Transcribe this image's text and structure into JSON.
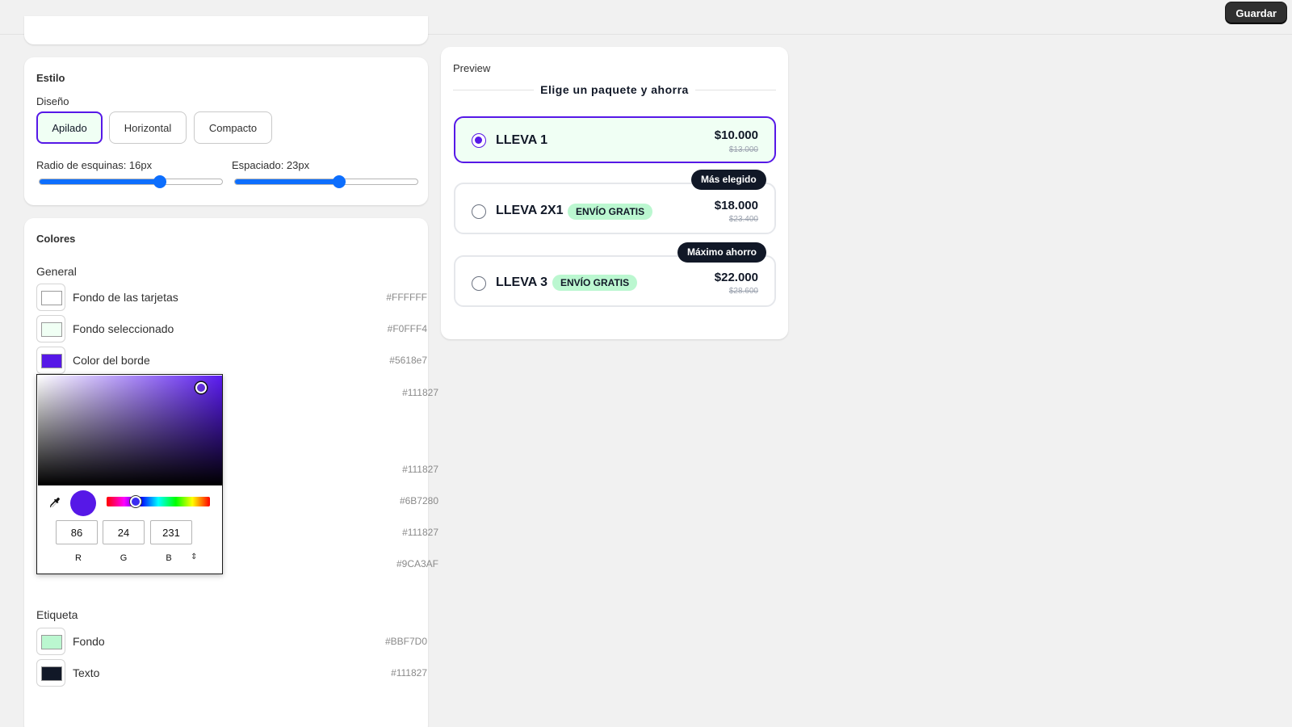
{
  "topbar": {
    "save_label": "Guardar"
  },
  "style": {
    "title": "Estilo",
    "design_label": "Diseño",
    "layouts": [
      "Apilado",
      "Horizontal",
      "Compacto"
    ],
    "selected_layout": "Apilado",
    "radius_label": "Radio de esquinas: 16px",
    "radius_value_fraction": 0.66,
    "spacing_label": "Espaciado: 23px",
    "spacing_value_fraction": 0.57
  },
  "colors": {
    "title": "Colores",
    "general_label": "General",
    "general": [
      {
        "name": "Fondo de las tarjetas",
        "hex": "#FFFFFF"
      },
      {
        "name": "Fondo seleccionado",
        "hex": "#F0FFF4"
      },
      {
        "name": "Color del borde",
        "hex": "#5618e7"
      }
    ],
    "hidden_hexes": [
      "#111827",
      "#111827",
      "#6B7280",
      "#111827",
      "#9CA3AF"
    ],
    "tag_label": "Etiqueta",
    "tag": [
      {
        "name": "Fondo",
        "hex": "#BBF7D0"
      },
      {
        "name": "Texto",
        "hex": "#111827"
      }
    ]
  },
  "picker": {
    "r": "86",
    "g": "24",
    "b": "231",
    "r_label": "R",
    "g_label": "G",
    "b_label": "B",
    "mode_toggle": "⇕",
    "color": "#5618e7"
  },
  "preview": {
    "title": "Preview",
    "heading": "Elige un paquete y ahorra",
    "bundles": [
      {
        "title": "LLEVA 1",
        "tag": "",
        "badge": "",
        "price": "$10.000",
        "old_price": "$13.000",
        "selected": true
      },
      {
        "title": "LLEVA 2X1",
        "tag": "ENVÍO GRATIS",
        "badge": "Más elegido",
        "price": "$18.000",
        "old_price": "$23.400",
        "selected": false
      },
      {
        "title": "LLEVA 3",
        "tag": "ENVÍO GRATIS",
        "badge": "Máximo ahorro",
        "price": "$22.000",
        "old_price": "$28.600",
        "selected": false
      }
    ]
  }
}
